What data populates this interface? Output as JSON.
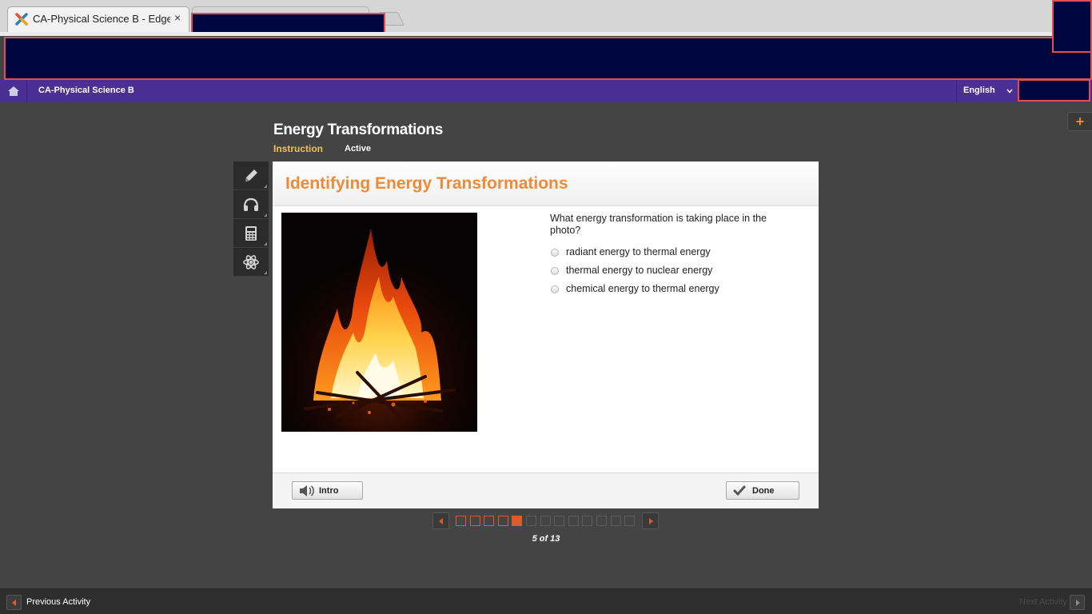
{
  "browser": {
    "active_tab_title": "CA-Physical Science B - Edgenuity",
    "tab_close": "×"
  },
  "nav": {
    "course_name": "CA-Physical Science B",
    "language": "English"
  },
  "lesson": {
    "title": "Energy Transformations",
    "mode": "Instruction",
    "status": "Active",
    "add_button": "+"
  },
  "activity": {
    "heading": "Identifying Energy Transformations",
    "question": "What energy transformation is taking place in the photo?",
    "choices": [
      "radiant energy to thermal energy",
      "thermal energy to nuclear energy",
      "chemical energy to thermal energy"
    ],
    "intro_button": "Intro",
    "done_button": "Done"
  },
  "tools": [
    "pencil-icon",
    "headphones-icon",
    "calculator-icon",
    "atom-icon"
  ],
  "pager": {
    "current": 5,
    "total": 13,
    "label": "5 of 13"
  },
  "footer": {
    "previous_label": "Previous Activity",
    "next_label": "Next Activity"
  },
  "colors": {
    "nav_purple": "#4b2f93",
    "heading_orange": "#ef8a37",
    "mode_yellow": "#f3c24a",
    "pager_orange": "#e05a2b"
  }
}
